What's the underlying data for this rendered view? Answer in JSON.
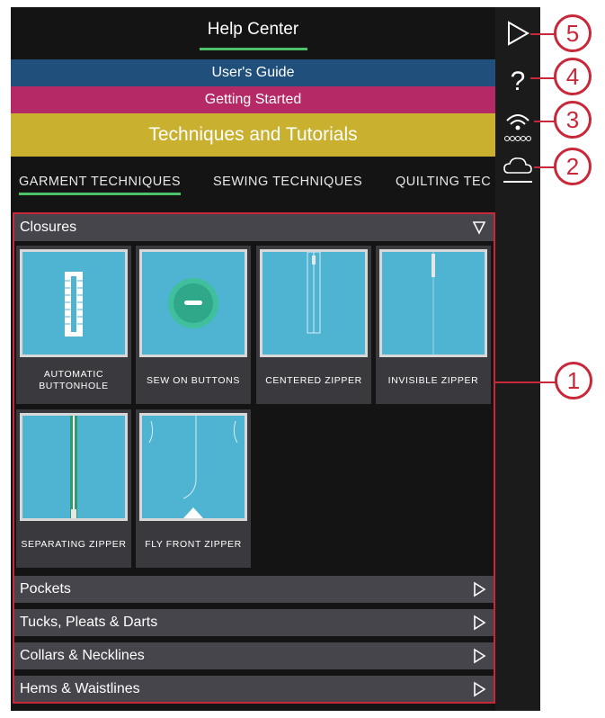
{
  "header": {
    "title": "Help Center"
  },
  "nav_bars": {
    "users_guide": "User's Guide",
    "getting_started": "Getting Started",
    "techniques": "Techniques and Tutorials"
  },
  "tabs": [
    {
      "label": "GARMENT TECHNIQUES",
      "active": true
    },
    {
      "label": "SEWING TECHNIQUES",
      "active": false
    },
    {
      "label": "QUILTING TEC",
      "active": false
    }
  ],
  "categories": {
    "closures": {
      "label": "Closures",
      "expanded": true
    },
    "pockets": {
      "label": "Pockets"
    },
    "tucks": {
      "label": "Tucks, Pleats & Darts"
    },
    "collars": {
      "label": "Collars & Necklines"
    },
    "hems": {
      "label": "Hems & Waistlines"
    }
  },
  "tiles": [
    {
      "label": "AUTOMATIC BUTTONHOLE"
    },
    {
      "label": "SEW ON BUTTONS"
    },
    {
      "label": "CENTERED ZIPPER"
    },
    {
      "label": "INVISIBLE ZIPPER"
    },
    {
      "label": "SEPARATING ZIPPER"
    },
    {
      "label": "FLY FRONT ZIPPER"
    }
  ],
  "rail_icons": [
    "play-icon",
    "help-icon",
    "wifi-icon",
    "cloud-icon"
  ],
  "callouts": {
    "c1": "1",
    "c2": "2",
    "c3": "3",
    "c4": "4",
    "c5": "5"
  },
  "colors": {
    "accent_green": "#4ec26a",
    "users_guide_bar": "#1f4f7a",
    "getting_started_bar": "#b52a66",
    "techniques_bar": "#c9b02f",
    "thumbnail_blue": "#4fb3d2",
    "callout_red": "#c8283a"
  }
}
